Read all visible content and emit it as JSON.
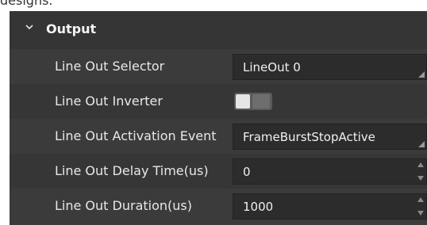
{
  "top_fragment": "designs.",
  "section": {
    "title": "Output",
    "icon": "chevron-down-icon",
    "expanded": true
  },
  "rows": [
    {
      "label": "Line Out Selector",
      "control": "select",
      "value": "LineOut 0"
    },
    {
      "label": "Line Out Inverter",
      "control": "toggle",
      "value": false
    },
    {
      "label": "Line Out Activation Event",
      "control": "select",
      "value": "FrameBurstStopActive"
    },
    {
      "label": "Line Out Delay Time(us)",
      "control": "spinbox",
      "value": "0"
    },
    {
      "label": "Line Out Duration(us)",
      "control": "spinbox",
      "value": "1000"
    }
  ],
  "colors": {
    "panel_bg": "#3b3b3b",
    "field_bg": "#2c2c2c",
    "text": "#e8e8e8"
  }
}
